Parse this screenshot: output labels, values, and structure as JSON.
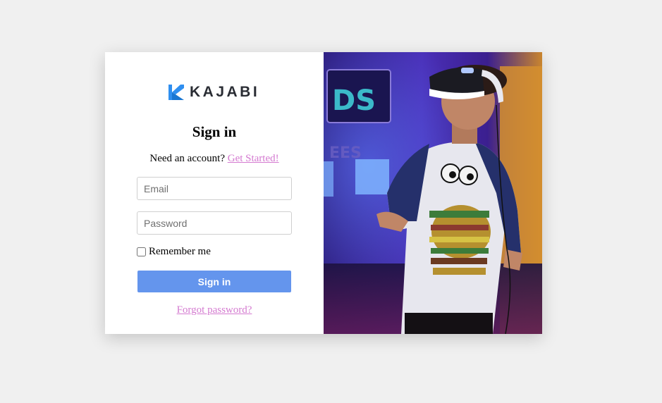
{
  "brand": {
    "name": "KAJABI",
    "accent": "#2f8ff0"
  },
  "form": {
    "title": "Sign in",
    "need_account_text": "Need an account?",
    "get_started_link": "Get Started!",
    "email_placeholder": "Email",
    "email_value": "",
    "password_placeholder": "Password",
    "password_value": "",
    "remember_label": "Remember me",
    "remember_checked": false,
    "submit_label": "Sign in",
    "forgot_link": "Forgot password?"
  },
  "colors": {
    "page_bg": "#f0f0f0",
    "button_bg": "#6495ed",
    "link": "#d47ad0"
  },
  "hero_image": {
    "icon": "vr-headset-person-photo"
  }
}
